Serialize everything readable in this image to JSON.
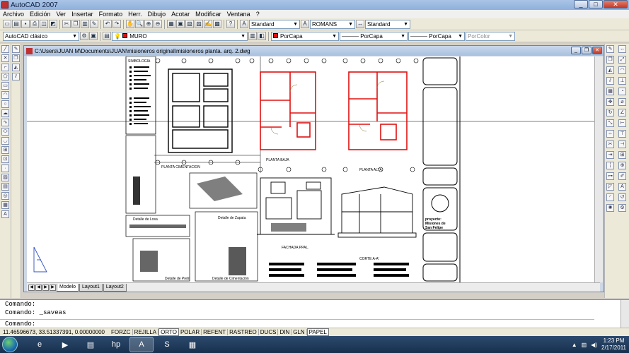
{
  "app": {
    "title": "AutoCAD 2007"
  },
  "menu": [
    "Archivo",
    "Edición",
    "Ver",
    "Insertar",
    "Formato",
    "Herr.",
    "Dibujo",
    "Acotar",
    "Modificar",
    "Ventana",
    "?"
  ],
  "toolbar": {
    "text_style": "Standard",
    "font": "ROMANS",
    "dim_style": "Standard",
    "workspace": "AutoCAD clásico",
    "layer": "MURO",
    "color": "PorCapa",
    "linetype": "PorCapa",
    "lineweight": "PorCapa",
    "plotstyle": "PorColor"
  },
  "drawing": {
    "title": "C:\\Users\\JUAN M\\Documents\\JUAN\\misioneros original\\misioneros planta. arq. 2.dwg",
    "labels": {
      "planta_cimentacion": "PLANTA CIMENTACION",
      "planta_baja": "PLANTA BAJA",
      "planta_alta": "PLANTA ALTA",
      "fachada": "FACHADA PPAL.",
      "corte": "CORTE A-A'",
      "detalle_zapata": "Detalle de Zapata",
      "detalle_cimentacion": "Detalle de Cimentación",
      "detalle_losa": "Detalle de Losa",
      "detalle_pretil": "Detalle de Pretil",
      "simbologia": "SIMBOLOGIA",
      "project_line1": "proyecto:",
      "project_line2": "Misiones de",
      "project_line3": "San Felipe"
    }
  },
  "layout_tabs": [
    "Modelo",
    "Layout1",
    "Layout2"
  ],
  "command": {
    "history": [
      "Comando:",
      "Comando: _saveas"
    ],
    "prompt": "Comando:"
  },
  "status": {
    "coords": "11.46596673, 33.51337391, 0.00000000",
    "buttons": [
      "FORZC",
      "REJILLA",
      "ORTO",
      "POLAR",
      "REFENT",
      "RASTREO",
      "DUCS",
      "DIN",
      "GLN",
      "PAPEL"
    ]
  },
  "taskbar": {
    "time": "1:23 PM",
    "date": "2/17/2011"
  },
  "colors": {
    "wall_red": "#e01010",
    "grid": "#000000",
    "title_blue": "#a9c1df"
  }
}
